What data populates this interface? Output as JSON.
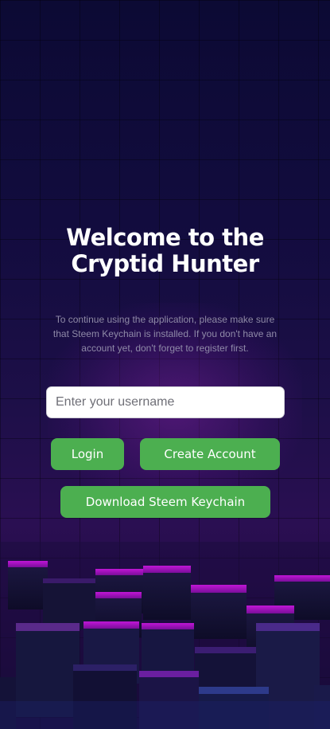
{
  "welcome": {
    "title_line1": "Welcome to the",
    "title_line2": "Cryptid Hunter",
    "description": "To continue using the application, please make sure that Steem Keychain is installed. If you don't have an account yet, don't forget to register first."
  },
  "form": {
    "username_placeholder": "Enter your username",
    "username_value": ""
  },
  "buttons": {
    "login": "Login",
    "create_account": "Create Account",
    "download_keychain": "Download Steem Keychain"
  },
  "colors": {
    "button_green": "#4caf50",
    "background_dark": "#0c0a34",
    "accent_purple": "#b01cc8"
  }
}
